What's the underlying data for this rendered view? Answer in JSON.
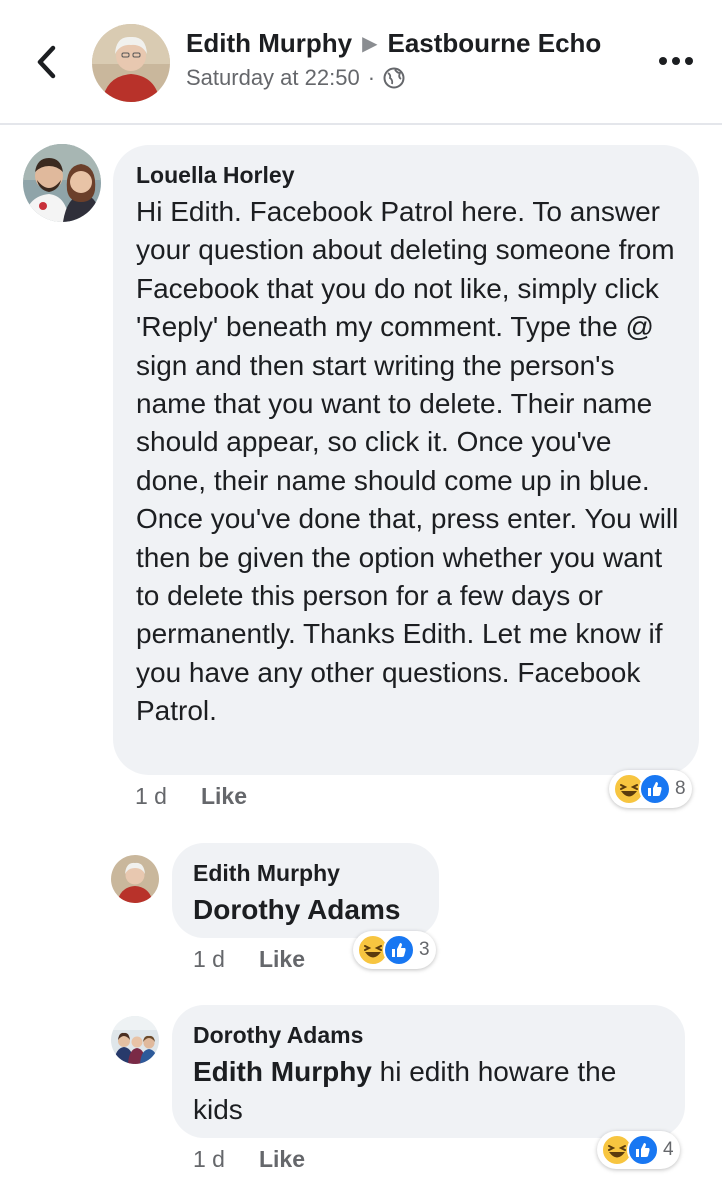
{
  "header": {
    "author": "Edith Murphy",
    "group": "Eastbourne Echo",
    "time": "Saturday at 22:50",
    "separator": "·",
    "icons": {
      "back": "chevron-left-icon",
      "audience": "globe-icon",
      "more": "more-icon",
      "arrow": "triangle-right-icon"
    }
  },
  "comments": [
    {
      "author": "Louella Horley",
      "text": "Hi Edith. Facebook Patrol here. To answer your question about deleting someone from Facebook that you do not like, simply click 'Reply' beneath my comment. Type the @ sign and then start writing the person's name that you want to delete. Their name should appear, so click it. Once you've done, their name should come up in blue. Once you've done that, press enter. You will then be given the option whether you want to delete this person for a few days or permanently. Thanks Edith. Let me know if you have any other questions. Facebook Patrol.",
      "age": "1 d",
      "like_label": "Like",
      "reaction_count": "8"
    }
  ],
  "replies": [
    {
      "author": "Edith Murphy",
      "mention": "Dorothy Adams",
      "text": "",
      "age": "1 d",
      "like_label": "Like",
      "reaction_count": "3"
    },
    {
      "author": "Dorothy Adams",
      "mention": "Edith Murphy",
      "text": " hi edith howare the kids",
      "age": "1 d",
      "like_label": "Like",
      "reaction_count": "4"
    }
  ],
  "colors": {
    "bubble": "#f0f2f5",
    "meta_text": "#65676b",
    "like_blue": "#1877f2",
    "haha_yellow": "#f7c540"
  }
}
